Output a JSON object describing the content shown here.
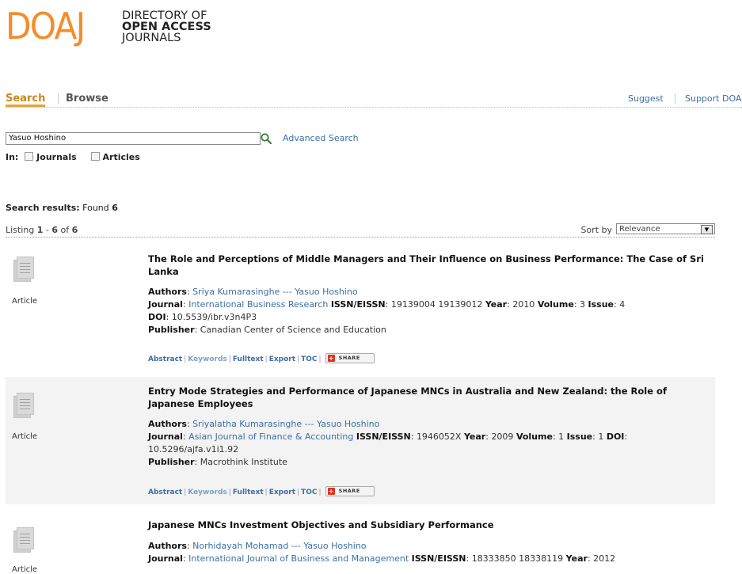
{
  "logo": {
    "mark": "DOAJ",
    "line1": "DIRECTORY OF",
    "line2": "OPEN ACCESS",
    "line3": "JOURNALS",
    "color": "#f38d2c"
  },
  "nav": {
    "tabs": [
      {
        "label": "Search",
        "active": true
      },
      {
        "label": "Browse",
        "active": false
      }
    ],
    "right_links": [
      "Suggest",
      "Support DOA"
    ]
  },
  "search": {
    "query": "Yasuo Hoshino",
    "advanced_label": "Advanced Search",
    "in_label": "In:",
    "options": [
      "Journals",
      "Articles"
    ]
  },
  "results": {
    "label": "Search results:",
    "found_prefix": "Found",
    "found_count": "6",
    "listing_prefix": "Listing",
    "range_start": "1",
    "range_end": "6",
    "of_word": "of",
    "total": "6",
    "sort_label": "Sort by",
    "sort_value": "Relevance",
    "actions": {
      "abstract": "Abstract",
      "keywords": "Keywords",
      "fulltext": "Fulltext",
      "export": "Export",
      "toc": "TOC",
      "share": "SHARE"
    },
    "items": [
      {
        "type": "Article",
        "title": "The Role and Perceptions of Middle Managers and Their Influence on Business Performance: The Case of Sri Lanka",
        "authors": "Sriya Kumarasinghe --- Yasuo Hoshino",
        "journal": "International Business Research",
        "issn": "19139004 19139012",
        "year": "2010",
        "volume": "3",
        "issue": "4",
        "doi": "10.5539/ibr.v3n4P3",
        "publisher": "Canadian Center of Science and Education"
      },
      {
        "type": "Article",
        "title": "Entry Mode Strategies and Performance of Japanese MNCs in Australia and New Zealand: the Role of Japanese Employees",
        "authors": "Sriyalatha Kumarasinghe --- Yasuo Hoshino",
        "journal": "Asian Journal of Finance & Accounting",
        "issn": "1946052X",
        "year": "2009",
        "volume": "1",
        "issue": "1",
        "doi": "10.5296/ajfa.v1i1.92",
        "publisher": "Macrothink Institute"
      },
      {
        "type": "Article",
        "title": "Japanese MNCs Investment Objectives and Subsidiary Performance",
        "authors": "Norhidayah Mohamad --- Yasuo Hoshino",
        "journal": "International Journal of Business and Management",
        "issn": "18333850 18338119",
        "year": "2012"
      }
    ]
  },
  "field_labels": {
    "authors": "Authors",
    "journal": "Journal",
    "issn": "ISSN/EISSN",
    "year": "Year",
    "volume": "Volume",
    "issue": "Issue",
    "doi": "DOI",
    "publisher": "Publisher"
  }
}
